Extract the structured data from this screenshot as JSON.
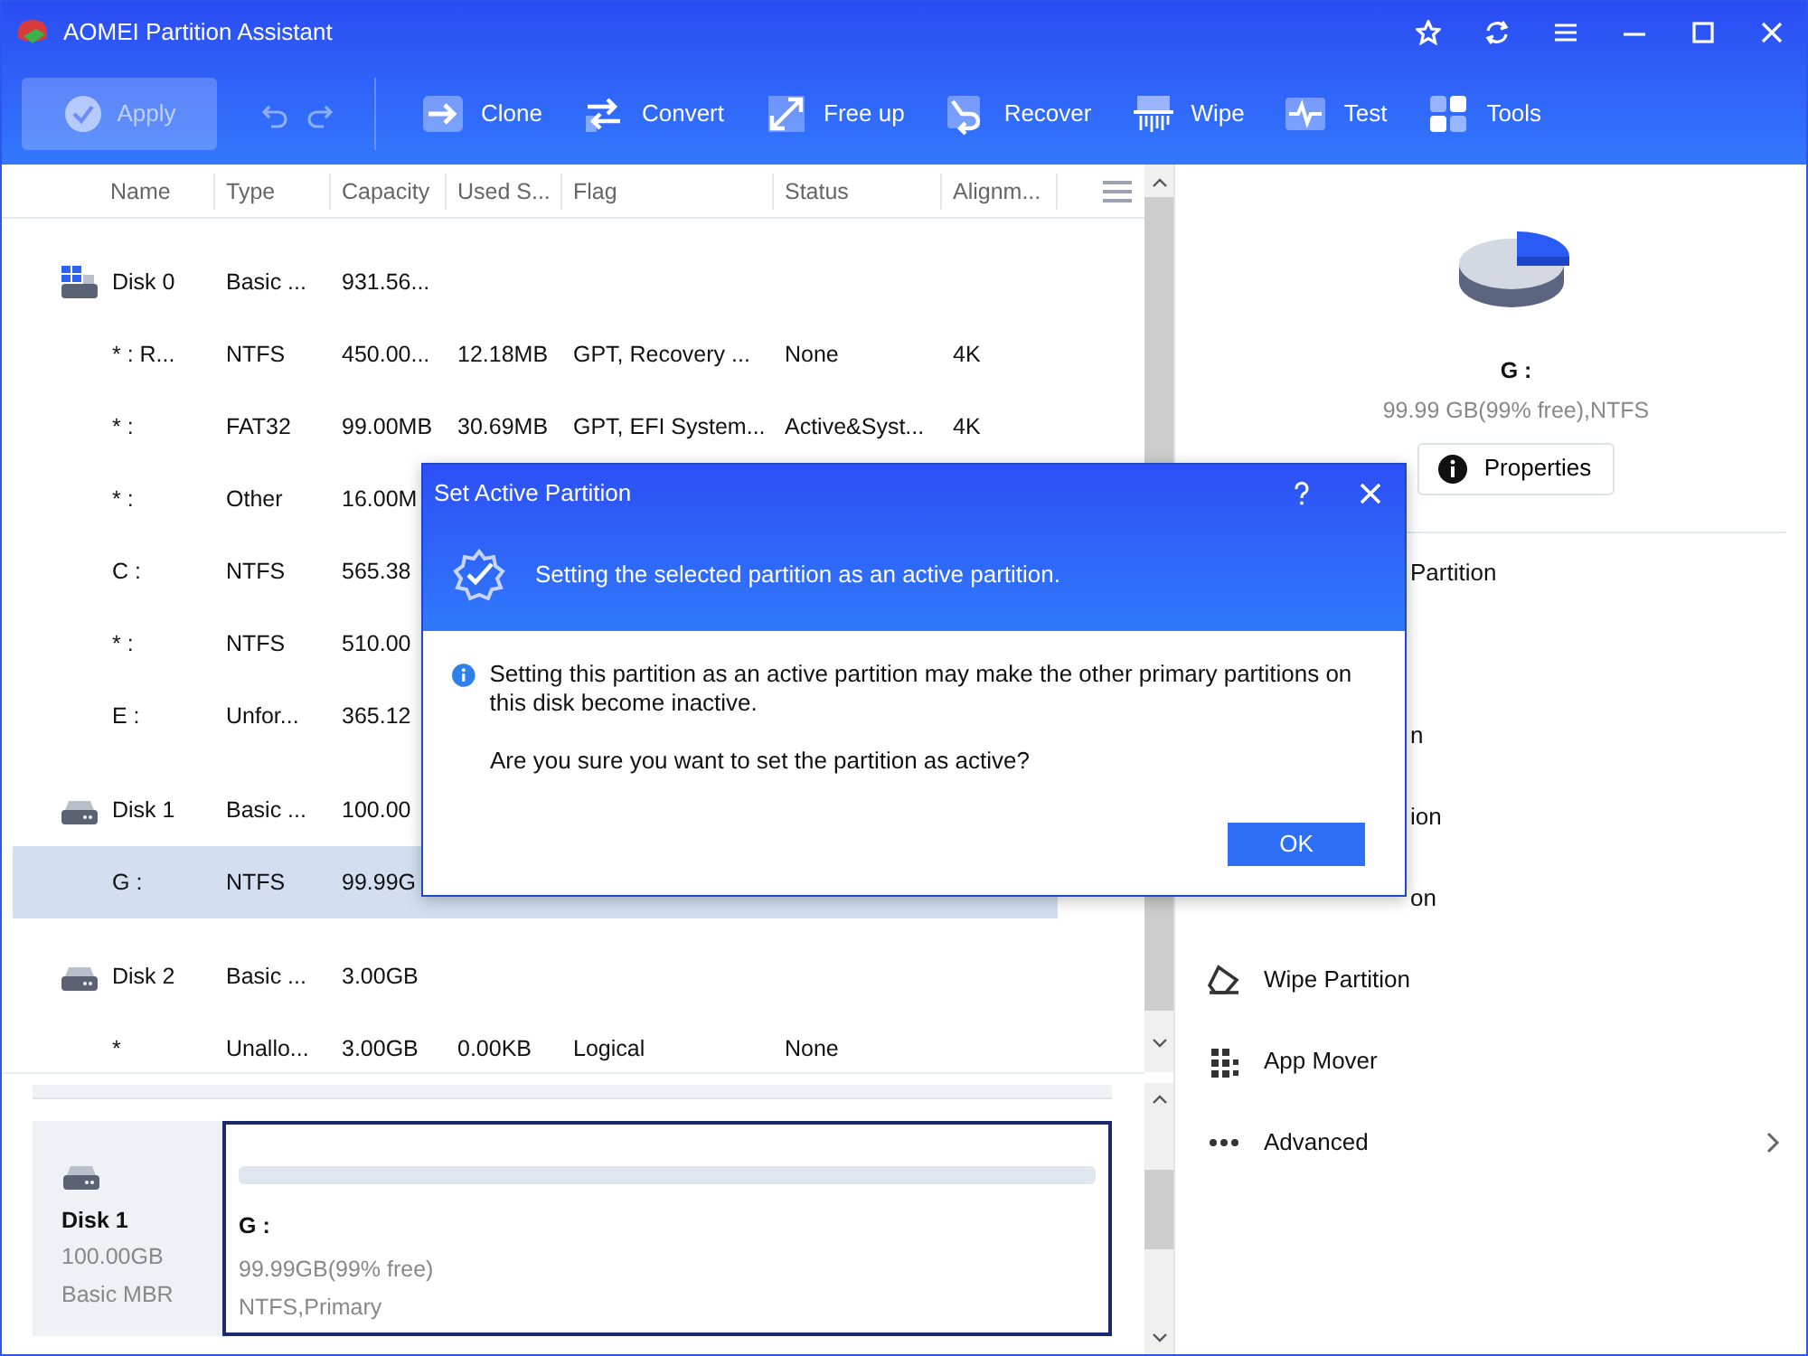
{
  "window": {
    "title": "AOMEI Partition Assistant"
  },
  "toolbar": {
    "apply": {
      "label": "Apply",
      "disabled": true
    },
    "history": [
      {
        "kind": "undo",
        "disabled": true
      },
      {
        "kind": "redo",
        "disabled": true
      }
    ],
    "tools": [
      {
        "kind": "clone",
        "label": "Clone"
      },
      {
        "kind": "convert",
        "label": "Convert"
      },
      {
        "kind": "freeup",
        "label": "Free up"
      },
      {
        "kind": "recover",
        "label": "Recover"
      },
      {
        "kind": "wipe",
        "label": "Wipe"
      },
      {
        "kind": "test",
        "label": "Test"
      },
      {
        "kind": "tools",
        "label": "Tools"
      }
    ]
  },
  "table": {
    "columns": [
      "Name",
      "Type",
      "Capacity",
      "Used S...",
      "Flag",
      "Status",
      "Alignm..."
    ],
    "rows": [
      {
        "kind": "system_disk",
        "selected": false,
        "cells": [
          "Disk 0",
          "Basic ...",
          "931.56..."
        ]
      },
      {
        "kind": "partition",
        "selected": false,
        "cells": [
          "* : R...",
          "NTFS",
          "450.00...",
          "12.18MB",
          "GPT, Recovery ...",
          "None",
          "4K"
        ]
      },
      {
        "kind": "partition",
        "selected": false,
        "cells": [
          "* :",
          "FAT32",
          "99.00MB",
          "30.69MB",
          "GPT, EFI System...",
          "Active&Syst...",
          "4K"
        ]
      },
      {
        "kind": "partition",
        "selected": false,
        "cells": [
          "* :",
          "Other",
          "16.00M"
        ]
      },
      {
        "kind": "partition",
        "selected": false,
        "cells": [
          "C :",
          "NTFS",
          "565.38"
        ]
      },
      {
        "kind": "partition",
        "selected": false,
        "cells": [
          "* :",
          "NTFS",
          "510.00"
        ]
      },
      {
        "kind": "partition",
        "selected": false,
        "cells": [
          "E :",
          "Unfor...",
          "365.12"
        ]
      },
      {
        "kind": "disk",
        "selected": false,
        "cells": [
          "Disk 1",
          "Basic ...",
          "100.00"
        ]
      },
      {
        "kind": "partition",
        "selected": true,
        "cells": [
          "G :",
          "NTFS",
          "99.99G"
        ]
      },
      {
        "kind": "disk",
        "selected": false,
        "cells": [
          "Disk 2",
          "Basic ...",
          "3.00GB"
        ]
      },
      {
        "kind": "partition",
        "selected": false,
        "cells": [
          "*",
          "Unallo...",
          "3.00GB",
          "0.00KB",
          "Logical",
          "None"
        ]
      }
    ]
  },
  "disk_map": {
    "disk": {
      "name": "Disk 1",
      "size": "100.00GB",
      "type": "Basic MBR"
    },
    "partitions": [
      {
        "name": "G :",
        "info": "99.99GB(99% free)",
        "fs": "NTFS,Primary",
        "selected": true
      }
    ]
  },
  "details": {
    "title": "G :",
    "info": "99.99 GB(99% free),NTFS",
    "properties": "Properties",
    "actions": [
      {
        "kind": "covered",
        "label": "Partition",
        "has_submenu": false
      },
      {
        "kind": "covered",
        "label": "n",
        "has_submenu": false
      },
      {
        "kind": "covered",
        "label": "ion",
        "has_submenu": false
      },
      {
        "kind": "covered",
        "label": "on",
        "has_submenu": false
      },
      {
        "kind": "wipe",
        "label": "Wipe Partition",
        "has_submenu": false
      },
      {
        "kind": "app_mover",
        "label": "App Mover",
        "has_submenu": false
      },
      {
        "kind": "advanced",
        "label": "Advanced",
        "has_submenu": true
      }
    ]
  },
  "dialog": {
    "title": "Set Active Partition",
    "banner": "Setting the selected partition as an active partition.",
    "message": "Setting this partition as an active partition may make the other primary partitions on this disk become inactive.",
    "question": "Are you sure you want to set the partition as active?",
    "ok": "OK"
  }
}
